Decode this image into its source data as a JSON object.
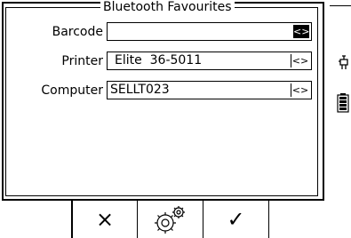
{
  "panel": {
    "title": "Bluetooth Favourites",
    "rows": [
      {
        "label": "Barcode",
        "value": "",
        "selector": "<>",
        "selected": true
      },
      {
        "label": "Printer",
        "value": "Elite  36-5011",
        "selector": "<>",
        "selected": false
      },
      {
        "label": "Computer",
        "value": "SELLT023",
        "selector": "<>",
        "selected": false
      }
    ]
  },
  "side_icons": [
    "plug-icon",
    "battery-icon"
  ],
  "softkeys": {
    "cancel": {
      "icon": "cross-icon",
      "glyph": "×"
    },
    "settings": {
      "icon": "gears-icon"
    },
    "confirm": {
      "icon": "checkmark-icon",
      "glyph": "✓"
    }
  }
}
